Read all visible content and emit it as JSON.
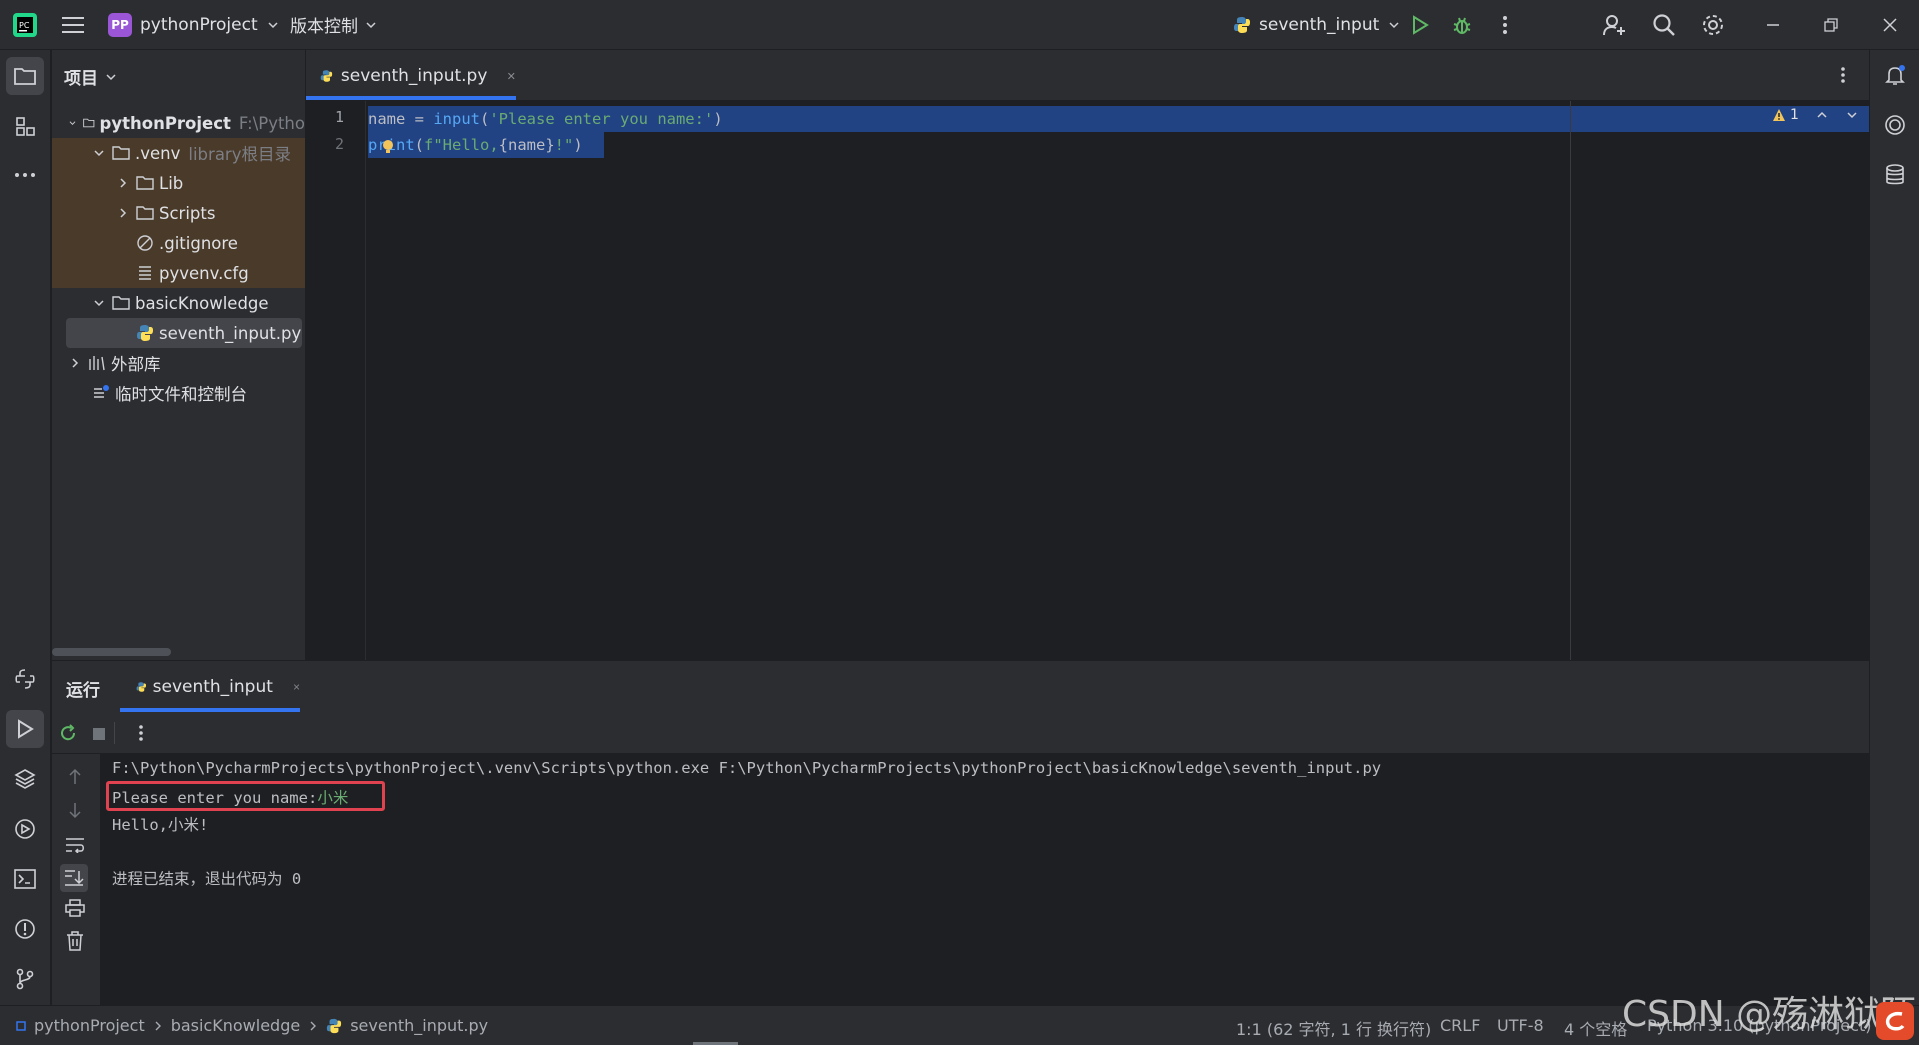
{
  "titlebar": {
    "project_badge": "PP",
    "project_name": "pythonProject",
    "vcs_menu": "版本控制",
    "run_config": "seventh_input"
  },
  "project_panel": {
    "title": "项目",
    "tree": [
      {
        "label": "pythonProject",
        "suffix": "F:\\Pytho",
        "icon": "folder-icon"
      },
      {
        "label": ".venv",
        "suffix": "library根目录",
        "icon": "folder-icon"
      },
      {
        "label": "Lib",
        "suffix": "",
        "icon": "folder-icon"
      },
      {
        "label": "Scripts",
        "suffix": "",
        "icon": "folder-icon"
      },
      {
        "label": ".gitignore",
        "suffix": "",
        "icon": "ignore-file-icon"
      },
      {
        "label": "pyvenv.cfg",
        "suffix": "",
        "icon": "config-file-icon"
      },
      {
        "label": "basicKnowledge",
        "suffix": "",
        "icon": "folder-icon"
      },
      {
        "label": "seventh_input.py",
        "suffix": "",
        "icon": "python-file-icon"
      },
      {
        "label": "外部库",
        "suffix": "",
        "icon": "library-icon"
      },
      {
        "label": "临时文件和控制台",
        "suffix": "",
        "icon": "scratch-icon"
      }
    ]
  },
  "editor": {
    "tab_label": "seventh_input.py",
    "line_numbers": [
      "1",
      "2"
    ],
    "line1": {
      "a": "name = ",
      "b": "input",
      "c": "(",
      "d": "'Please enter you name:'",
      "e": ")"
    },
    "line2": {
      "a": "print",
      "b": "(",
      "c": "f\"Hello,",
      "d": "{name}",
      "e": "!\"",
      "f": ")"
    },
    "warning_count": "1"
  },
  "run_panel": {
    "title": "运行",
    "tab_label": "seventh_input",
    "console": {
      "command": "F:\\Python\\PycharmProjects\\pythonProject\\.venv\\Scripts\\python.exe F:\\Python\\PycharmProjects\\pythonProject\\basicKnowledge\\seventh_input.py",
      "prompt": "Please enter you name:",
      "user_input": "小米",
      "output": "Hello,小米!",
      "exit_message": "进程已结束，退出代码为 0"
    }
  },
  "statusbar": {
    "breadcrumb": [
      "pythonProject",
      "basicKnowledge",
      "seventh_input.py"
    ],
    "position": "1:1 (62 字符, 1 行 换行符)",
    "line_sep": "CRLF",
    "encoding": "UTF-8",
    "indent": "4 个空格",
    "interpreter": "Python 3.10 (pythonProject)"
  },
  "watermark": "CSDN @殇淋狱陌",
  "colors": {
    "accent": "#3574f0",
    "selection": "#214283",
    "string": "#6aab73",
    "function": "#56a8f5",
    "highlight_box": "#e0434f",
    "venv_bg": "#4a3a29"
  }
}
